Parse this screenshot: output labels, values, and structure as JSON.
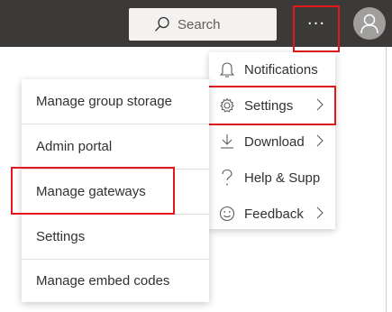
{
  "header": {
    "search_placeholder": "Search",
    "more_options_label": "···"
  },
  "more_menu": {
    "items": [
      {
        "label": "Notifications",
        "icon": "bell-icon"
      },
      {
        "label": "Settings",
        "icon": "gear-icon",
        "has_submenu": true
      },
      {
        "label": "Download",
        "icon": "download-icon",
        "has_submenu": true
      },
      {
        "label": "Help & Supp",
        "icon": "question-icon",
        "has_submenu": true
      },
      {
        "label": "Feedback",
        "icon": "smiley-icon",
        "has_submenu": true
      }
    ]
  },
  "settings_submenu": {
    "items": [
      {
        "label": "Manage group storage"
      },
      {
        "label": "Admin portal"
      },
      {
        "label": "Manage gateways"
      },
      {
        "label": "Settings"
      },
      {
        "label": "Manage embed codes"
      }
    ]
  },
  "colors": {
    "topbar": "#3b3a39",
    "highlight": "#e3171b",
    "avatar": "#a19f9d"
  }
}
